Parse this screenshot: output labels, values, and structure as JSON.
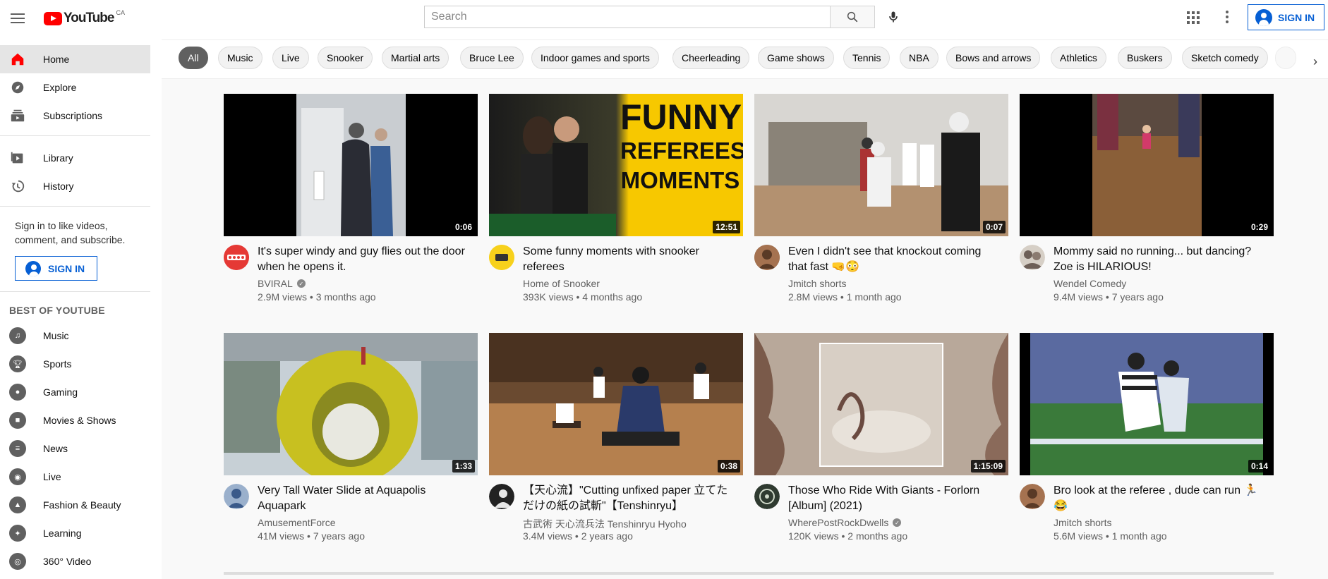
{
  "topbar": {
    "logo_text": "YouTube",
    "logo_country": "CA",
    "search_placeholder": "Search",
    "sign_in": "SIGN IN"
  },
  "sidebar": {
    "primary": [
      {
        "label": "Home",
        "icon": "home-icon",
        "active": true
      },
      {
        "label": "Explore",
        "icon": "compass-icon"
      },
      {
        "label": "Subscriptions",
        "icon": "subscriptions-icon"
      }
    ],
    "secondary": [
      {
        "label": "Library",
        "icon": "library-icon"
      },
      {
        "label": "History",
        "icon": "history-icon"
      }
    ],
    "signin_note": "Sign in to like videos, comment, and subscribe.",
    "signin_button": "SIGN IN",
    "section_title": "BEST OF YOUTUBE",
    "best_of": [
      {
        "label": "Music",
        "icon": "music-icon"
      },
      {
        "label": "Sports",
        "icon": "trophy-icon"
      },
      {
        "label": "Gaming",
        "icon": "gamepad-icon"
      },
      {
        "label": "Movies & Shows",
        "icon": "film-icon"
      },
      {
        "label": "News",
        "icon": "newspaper-icon"
      },
      {
        "label": "Live",
        "icon": "live-icon"
      },
      {
        "label": "Fashion & Beauty",
        "icon": "hanger-icon"
      },
      {
        "label": "Learning",
        "icon": "lightbulb-icon"
      },
      {
        "label": "360° Video",
        "icon": "360-icon"
      }
    ]
  },
  "chips": [
    "All",
    "Music",
    "Live",
    "Snooker",
    "Martial arts",
    "Bruce Lee",
    "Indoor games and sports",
    "Cheerleading",
    "Game shows",
    "Tennis",
    "NBA",
    "Bows and arrows",
    "Athletics",
    "Buskers",
    "Sketch comedy"
  ],
  "videos": [
    {
      "title": "It's super windy and guy flies out the door when he opens it.",
      "channel": "BVIRAL",
      "verified": true,
      "views": "2.9M views",
      "age": "3 months ago",
      "duration": "0:06",
      "avatar_text": "bviral",
      "avatar_color": "#e53935"
    },
    {
      "title": "Some funny moments with snooker referees",
      "channel": "Home of Snooker",
      "verified": false,
      "views": "393K views",
      "age": "4 months ago",
      "duration": "12:51",
      "avatar_text": "home snooker",
      "avatar_color": "#f7d11c",
      "thumb_text": [
        "FUNNY",
        "REFEREES",
        "MOMENTS"
      ]
    },
    {
      "title": "Even I didn't see that knockout coming that fast 🤜😳",
      "channel": "Jmitch shorts",
      "verified": false,
      "views": "2.8M views",
      "age": "1 month ago",
      "duration": "0:07",
      "avatar_text": "",
      "avatar_color": "#8a5a3a"
    },
    {
      "title": "Mommy said no running... but dancing? Zoe is HILARIOUS!",
      "channel": "Wendel Comedy",
      "verified": false,
      "views": "9.4M views",
      "age": "7 years ago",
      "duration": "0:29",
      "avatar_text": "",
      "avatar_color": "#6d5f57"
    },
    {
      "title": "Very Tall Water Slide at Aquapolis Aquapark",
      "channel": "AmusementForce",
      "verified": false,
      "views": "41M views",
      "age": "7 years ago",
      "duration": "1:33",
      "avatar_text": "",
      "avatar_color": "#3a5a8a"
    },
    {
      "title": "【天心流】\"Cutting unfixed paper 立てただけの紙の試斬\"【Tenshinryu】",
      "channel": "古武術 天心流兵法 Tenshinryu Hyoho",
      "verified": false,
      "views": "3.4M views",
      "age": "2 years ago",
      "duration": "0:38",
      "avatar_text": "",
      "avatar_color": "#222222"
    },
    {
      "title": "Those Who Ride With Giants - Forlorn [Album] (2021)",
      "channel": "WherePostRockDwells",
      "verified": true,
      "views": "120K views",
      "age": "2 months ago",
      "duration": "1:15:09",
      "avatar_text": "",
      "avatar_color": "#2f3a30"
    },
    {
      "title": "Bro look at the referee , dude can run 🏃😂",
      "channel": "Jmitch shorts",
      "verified": false,
      "views": "5.6M views",
      "age": "1 month ago",
      "duration": "0:14",
      "avatar_text": "",
      "avatar_color": "#8a5a3a"
    }
  ]
}
